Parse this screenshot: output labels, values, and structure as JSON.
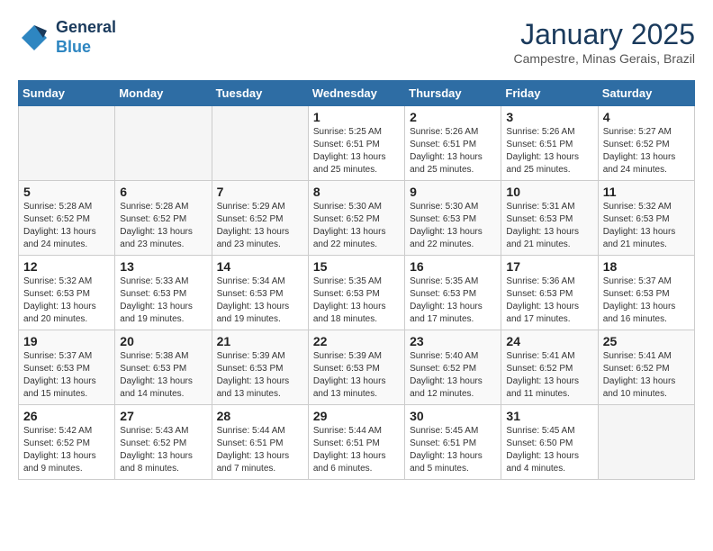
{
  "header": {
    "logo_line1": "General",
    "logo_line2": "Blue",
    "month": "January 2025",
    "location": "Campestre, Minas Gerais, Brazil"
  },
  "weekdays": [
    "Sunday",
    "Monday",
    "Tuesday",
    "Wednesday",
    "Thursday",
    "Friday",
    "Saturday"
  ],
  "weeks": [
    [
      {
        "day": "",
        "info": ""
      },
      {
        "day": "",
        "info": ""
      },
      {
        "day": "",
        "info": ""
      },
      {
        "day": "1",
        "info": "Sunrise: 5:25 AM\nSunset: 6:51 PM\nDaylight: 13 hours\nand 25 minutes."
      },
      {
        "day": "2",
        "info": "Sunrise: 5:26 AM\nSunset: 6:51 PM\nDaylight: 13 hours\nand 25 minutes."
      },
      {
        "day": "3",
        "info": "Sunrise: 5:26 AM\nSunset: 6:51 PM\nDaylight: 13 hours\nand 25 minutes."
      },
      {
        "day": "4",
        "info": "Sunrise: 5:27 AM\nSunset: 6:52 PM\nDaylight: 13 hours\nand 24 minutes."
      }
    ],
    [
      {
        "day": "5",
        "info": "Sunrise: 5:28 AM\nSunset: 6:52 PM\nDaylight: 13 hours\nand 24 minutes."
      },
      {
        "day": "6",
        "info": "Sunrise: 5:28 AM\nSunset: 6:52 PM\nDaylight: 13 hours\nand 23 minutes."
      },
      {
        "day": "7",
        "info": "Sunrise: 5:29 AM\nSunset: 6:52 PM\nDaylight: 13 hours\nand 23 minutes."
      },
      {
        "day": "8",
        "info": "Sunrise: 5:30 AM\nSunset: 6:52 PM\nDaylight: 13 hours\nand 22 minutes."
      },
      {
        "day": "9",
        "info": "Sunrise: 5:30 AM\nSunset: 6:53 PM\nDaylight: 13 hours\nand 22 minutes."
      },
      {
        "day": "10",
        "info": "Sunrise: 5:31 AM\nSunset: 6:53 PM\nDaylight: 13 hours\nand 21 minutes."
      },
      {
        "day": "11",
        "info": "Sunrise: 5:32 AM\nSunset: 6:53 PM\nDaylight: 13 hours\nand 21 minutes."
      }
    ],
    [
      {
        "day": "12",
        "info": "Sunrise: 5:32 AM\nSunset: 6:53 PM\nDaylight: 13 hours\nand 20 minutes."
      },
      {
        "day": "13",
        "info": "Sunrise: 5:33 AM\nSunset: 6:53 PM\nDaylight: 13 hours\nand 19 minutes."
      },
      {
        "day": "14",
        "info": "Sunrise: 5:34 AM\nSunset: 6:53 PM\nDaylight: 13 hours\nand 19 minutes."
      },
      {
        "day": "15",
        "info": "Sunrise: 5:35 AM\nSunset: 6:53 PM\nDaylight: 13 hours\nand 18 minutes."
      },
      {
        "day": "16",
        "info": "Sunrise: 5:35 AM\nSunset: 6:53 PM\nDaylight: 13 hours\nand 17 minutes."
      },
      {
        "day": "17",
        "info": "Sunrise: 5:36 AM\nSunset: 6:53 PM\nDaylight: 13 hours\nand 17 minutes."
      },
      {
        "day": "18",
        "info": "Sunrise: 5:37 AM\nSunset: 6:53 PM\nDaylight: 13 hours\nand 16 minutes."
      }
    ],
    [
      {
        "day": "19",
        "info": "Sunrise: 5:37 AM\nSunset: 6:53 PM\nDaylight: 13 hours\nand 15 minutes."
      },
      {
        "day": "20",
        "info": "Sunrise: 5:38 AM\nSunset: 6:53 PM\nDaylight: 13 hours\nand 14 minutes."
      },
      {
        "day": "21",
        "info": "Sunrise: 5:39 AM\nSunset: 6:53 PM\nDaylight: 13 hours\nand 13 minutes."
      },
      {
        "day": "22",
        "info": "Sunrise: 5:39 AM\nSunset: 6:53 PM\nDaylight: 13 hours\nand 13 minutes."
      },
      {
        "day": "23",
        "info": "Sunrise: 5:40 AM\nSunset: 6:52 PM\nDaylight: 13 hours\nand 12 minutes."
      },
      {
        "day": "24",
        "info": "Sunrise: 5:41 AM\nSunset: 6:52 PM\nDaylight: 13 hours\nand 11 minutes."
      },
      {
        "day": "25",
        "info": "Sunrise: 5:41 AM\nSunset: 6:52 PM\nDaylight: 13 hours\nand 10 minutes."
      }
    ],
    [
      {
        "day": "26",
        "info": "Sunrise: 5:42 AM\nSunset: 6:52 PM\nDaylight: 13 hours\nand 9 minutes."
      },
      {
        "day": "27",
        "info": "Sunrise: 5:43 AM\nSunset: 6:52 PM\nDaylight: 13 hours\nand 8 minutes."
      },
      {
        "day": "28",
        "info": "Sunrise: 5:44 AM\nSunset: 6:51 PM\nDaylight: 13 hours\nand 7 minutes."
      },
      {
        "day": "29",
        "info": "Sunrise: 5:44 AM\nSunset: 6:51 PM\nDaylight: 13 hours\nand 6 minutes."
      },
      {
        "day": "30",
        "info": "Sunrise: 5:45 AM\nSunset: 6:51 PM\nDaylight: 13 hours\nand 5 minutes."
      },
      {
        "day": "31",
        "info": "Sunrise: 5:45 AM\nSunset: 6:50 PM\nDaylight: 13 hours\nand 4 minutes."
      },
      {
        "day": "",
        "info": ""
      }
    ]
  ]
}
